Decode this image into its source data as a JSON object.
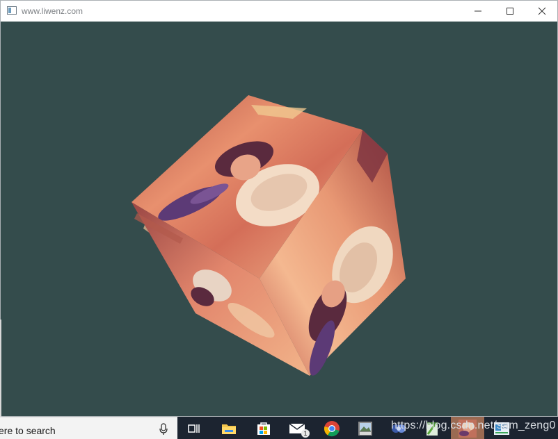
{
  "window": {
    "title": "www.liwenz.com",
    "controls": {
      "minimize_icon": "minimize-icon",
      "maximize_icon": "maximize-icon",
      "close_icon": "close-icon"
    }
  },
  "viewport": {
    "background": "#344c4c",
    "content": "rotating textured cube"
  },
  "taskbar": {
    "search_text": "ere to search",
    "apps": [
      {
        "name": "task-view",
        "icon": "task-view-icon"
      },
      {
        "name": "file-explorer",
        "icon": "folder-icon"
      },
      {
        "name": "microsoft-store",
        "icon": "store-icon"
      },
      {
        "name": "mail",
        "icon": "mail-icon",
        "badge": "1"
      },
      {
        "name": "chrome",
        "icon": "chrome-icon"
      },
      {
        "name": "photos",
        "icon": "photos-icon"
      },
      {
        "name": "app",
        "icon": "app-icon"
      },
      {
        "name": "notepad",
        "icon": "notepad-icon"
      },
      {
        "name": "opengl-window",
        "icon": "lena-icon",
        "active": true
      },
      {
        "name": "app",
        "icon": "app-icon"
      }
    ]
  },
  "watermark": "https://blog.csdn.net/sam_zeng0",
  "colors": {
    "accent": "#9a6a52",
    "taskbar": "#1c2430"
  }
}
